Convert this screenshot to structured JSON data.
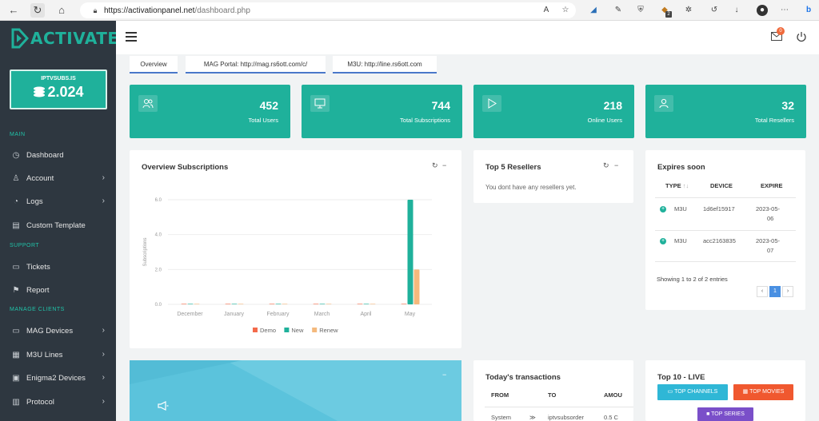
{
  "browser": {
    "url_host": "https://activationpanel.net",
    "url_path": "/dashboard.php",
    "extensions": [
      "read-aloud",
      "favorite",
      "ext-1",
      "ext-2",
      "ext-3",
      "ext-4",
      "ext-5",
      "history",
      "download",
      "profile",
      "bing"
    ],
    "ext_badge": "2"
  },
  "brand": {
    "logo_text": "ACTIVATE",
    "accent": "#1fb19b",
    "sidebar_bg": "#2e3740"
  },
  "balance": {
    "site": "IPTVSUBS.IS",
    "amount": "2.024"
  },
  "sidebar": {
    "sections": [
      {
        "label": "MAIN"
      },
      {
        "label": "SUPPORT"
      },
      {
        "label": "MANAGE CLIENTS"
      }
    ],
    "items": [
      {
        "label": "Dashboard",
        "icon": "speedometer-icon",
        "chevron": false
      },
      {
        "label": "Account",
        "icon": "user-icon",
        "chevron": true
      },
      {
        "label": "Logs",
        "icon": "clock-icon",
        "chevron": true
      },
      {
        "label": "Custom Template",
        "icon": "document-icon",
        "chevron": false
      },
      {
        "label": "Tickets",
        "icon": "ticket-icon",
        "chevron": false
      },
      {
        "label": "Report",
        "icon": "flag-icon",
        "chevron": false
      },
      {
        "label": "MAG Devices",
        "icon": "monitor-icon",
        "chevron": true
      },
      {
        "label": "M3U Lines",
        "icon": "film-icon",
        "chevron": true
      },
      {
        "label": "Enigma2 Devices",
        "icon": "box-icon",
        "chevron": true
      },
      {
        "label": "Protocol",
        "icon": "barcode-icon",
        "chevron": true
      }
    ]
  },
  "header": {
    "notification_count": "0"
  },
  "tabs": [
    {
      "label": "Overview"
    },
    {
      "label": "MAG Portal: http://mag.rs6ott.com/c/"
    },
    {
      "label": "M3U: http://line.rs6ott.com"
    }
  ],
  "stats": [
    {
      "value": "452",
      "label": "Total Users",
      "icon": "users-icon"
    },
    {
      "value": "744",
      "label": "Total Subscriptions",
      "icon": "monitor-icon"
    },
    {
      "value": "218",
      "label": "Online Users",
      "icon": "play-icon"
    },
    {
      "value": "32",
      "label": "Total Resellers",
      "icon": "user-icon"
    }
  ],
  "overview": {
    "title": "Overview Subscriptions",
    "refresh_glyph": "↻",
    "collapse_glyph": "−"
  },
  "chart_data": {
    "type": "bar",
    "title": "Overview Subscriptions",
    "xlabel": "",
    "ylabel": "Subscriptions",
    "categories": [
      "December",
      "January",
      "February",
      "March",
      "April",
      "May"
    ],
    "series": [
      {
        "name": "Demo",
        "color": "#f46a4b",
        "values": [
          0,
          0,
          0,
          0,
          0,
          0
        ]
      },
      {
        "name": "New",
        "color": "#1fb19b",
        "values": [
          0,
          0,
          0,
          0,
          0,
          6
        ]
      },
      {
        "name": "Renew",
        "color": "#f4b97d",
        "values": [
          0,
          0,
          0,
          0,
          0,
          2
        ]
      }
    ],
    "yticks": [
      "0.0",
      "2.0",
      "4.0",
      "6.0"
    ],
    "ylim": [
      0,
      6
    ],
    "grid": true,
    "legend": "bottom"
  },
  "resellers": {
    "title": "Top 5 Resellers",
    "empty_text": "You dont have any resellers yet.",
    "refresh_glyph": "↻",
    "collapse_glyph": "−"
  },
  "expires": {
    "title": "Expires soon",
    "columns": [
      "TYPE",
      "DEVICE",
      "EXPIRE"
    ],
    "sort_glyph": "↑↓",
    "rows": [
      {
        "type": "M3U",
        "device": "1d6ef15917",
        "expire_1": "2023-05-",
        "expire_2": "06"
      },
      {
        "type": "M3U",
        "device": "acc2163835",
        "expire_1": "2023-05-",
        "expire_2": "07"
      }
    ],
    "showing": "Showing 1 to 2 of 2 entries",
    "pager": [
      "‹",
      "1",
      "›"
    ]
  },
  "blue_panel": {
    "collapse_glyph": "−"
  },
  "transactions": {
    "title": "Today's transactions",
    "columns": [
      "FROM",
      "TO",
      "AMOU"
    ],
    "rows": [
      {
        "from": "System",
        "arrow": "≫",
        "to": "iptvsubsorder",
        "amount": "0.5 C"
      }
    ]
  },
  "top10": {
    "title": "Top 10 - LIVE",
    "buttons": [
      {
        "label": "TOP CHANNELS",
        "color": "#2fb7d6"
      },
      {
        "label": "TOP MOVIES",
        "color": "#f0582f"
      },
      {
        "label": "TOP SERIES",
        "color": "#7a4fc9"
      }
    ]
  }
}
